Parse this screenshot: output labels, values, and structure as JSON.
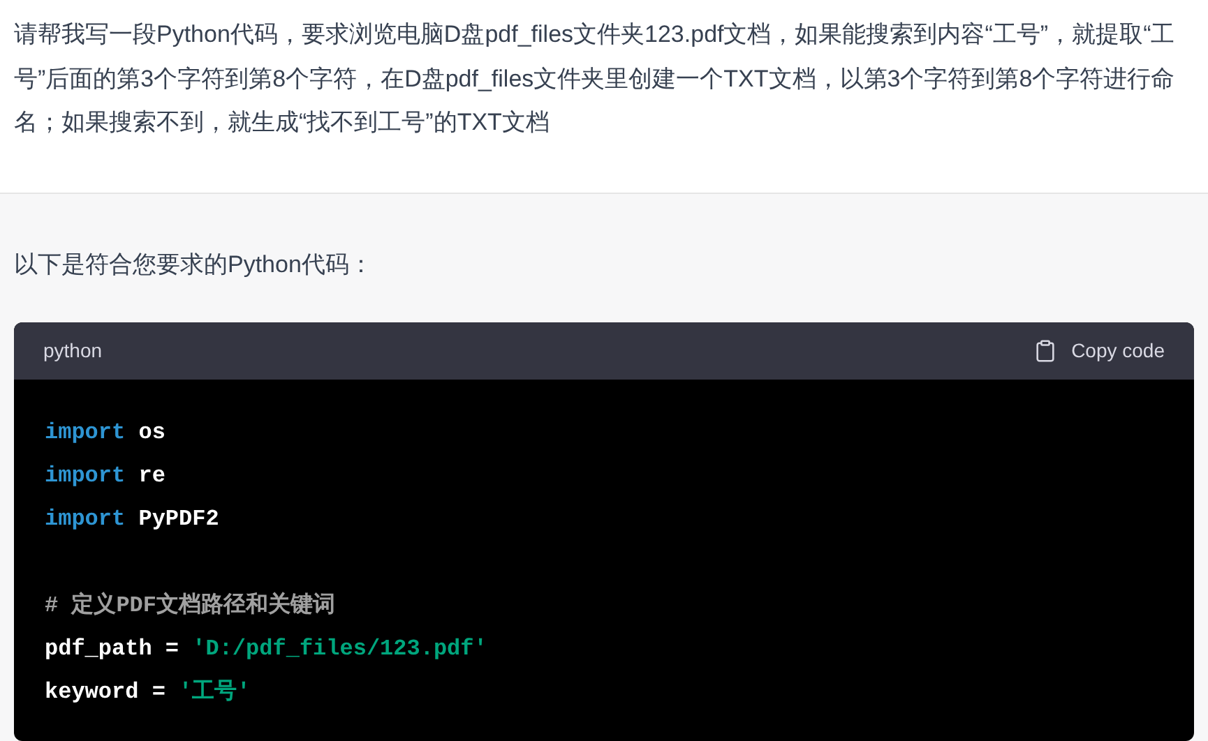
{
  "user_message": {
    "text": "请帮我写一段Python代码，要求浏览电脑D盘pdf_files文件夹123.pdf文档，如果能搜索到内容“工号”，就提取“工号”后面的第3个字符到第8个字符，在D盘pdf_files文件夹里创建一个TXT文档，以第3个字符到第8个字符进行命名；如果搜索不到，就生成“找不到工号”的TXT文档"
  },
  "assistant_message": {
    "intro": "以下是符合您要求的Python代码：",
    "code_block": {
      "language": "python",
      "copy_button": "Copy code",
      "lines": [
        {
          "kind": "code",
          "tokens": [
            {
              "kind": "keyword",
              "text": "import"
            },
            {
              "kind": "plain",
              "text": " os"
            }
          ]
        },
        {
          "kind": "code",
          "tokens": [
            {
              "kind": "keyword",
              "text": "import"
            },
            {
              "kind": "plain",
              "text": " re"
            }
          ]
        },
        {
          "kind": "code",
          "tokens": [
            {
              "kind": "keyword",
              "text": "import"
            },
            {
              "kind": "plain",
              "text": " PyPDF2"
            }
          ]
        },
        {
          "kind": "blank"
        },
        {
          "kind": "code",
          "tokens": [
            {
              "kind": "comment",
              "text": "# 定义PDF文档路径和关键词"
            }
          ]
        },
        {
          "kind": "code",
          "tokens": [
            {
              "kind": "plain",
              "text": "pdf_path = "
            },
            {
              "kind": "string",
              "text": "'D:/pdf_files/123.pdf'"
            }
          ]
        },
        {
          "kind": "code",
          "tokens": [
            {
              "kind": "plain",
              "text": "keyword = "
            },
            {
              "kind": "string",
              "text": "'工号'"
            }
          ]
        }
      ]
    }
  }
}
